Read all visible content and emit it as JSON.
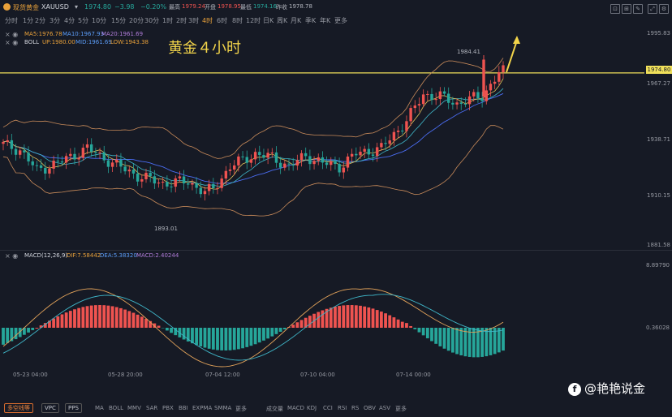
{
  "header": {
    "symbol_name": "现货黄金",
    "symbol_code": "XAUUSD",
    "dropdown": "▾",
    "last_price": "1974.80",
    "change": "−3.98",
    "change_pct": "−0.20%",
    "high_label": "最高",
    "high_value": "1979.24",
    "open_label": "开盘",
    "open_value": "1978.95",
    "low_label": "最低",
    "low_value": "1974.16",
    "prev_close_label": "昨收",
    "prev_close_value": "1978.78"
  },
  "timeframes": [
    "分时",
    "1分",
    "2分",
    "3分",
    "4分",
    "5分",
    "10分",
    "15分",
    "20分",
    "30分",
    "1时",
    "2时",
    "3时",
    "4时",
    "6时",
    "8时",
    "12时",
    "日K",
    "周K",
    "月K",
    "季K",
    "年K",
    "更多"
  ],
  "timeframe_active": "4时",
  "ma_line": {
    "label": "MA5:1976.78",
    "ma10": "MA10:1967.93",
    "ma20": "MA20:1961.69"
  },
  "boll_line": {
    "label": "BOLL",
    "up": "UP:1980.00",
    "mid": "MID:1961.69",
    "low": "LOW:1943.38"
  },
  "macd_line": {
    "label": "MACD(12,26,9)",
    "dif": "DIF:7.58442",
    "dea": "DEA:5.38320",
    "macd": "MACD:2.40244"
  },
  "overlay_title": "黄金４小时",
  "price_axis": [
    "1995.83",
    "1974.80",
    "1967.27",
    "1938.71",
    "1910.15",
    "1881.58"
  ],
  "macd_axis": [
    "8.89790",
    "0.36028"
  ],
  "annotations": {
    "high": "1984.41",
    "low": "1893.01"
  },
  "time_axis": [
    "05-23 04:00",
    "05-28 20:00",
    "07-04 12:00",
    "07-10 04:00",
    "07-14 00:00"
  ],
  "bottom_tags": [
    "多空线等",
    "VPC",
    "PPS"
  ],
  "tools": [
    "MA",
    "BOLL",
    "MMV",
    "SAR",
    "PBX",
    "BBI",
    "EXPMA",
    "SMMA",
    "更多",
    "成交量",
    "MACD",
    "KDJ",
    "CCI",
    "RSI",
    "RS",
    "OBV",
    "ASV",
    "更多"
  ],
  "watermark": "@艳艳说金",
  "watermark_icon": "facebook-icon",
  "colors": {
    "up": "#ef5350",
    "down": "#26a69a",
    "price_line": "#f0e05a",
    "accent": "#e9a13a"
  }
}
